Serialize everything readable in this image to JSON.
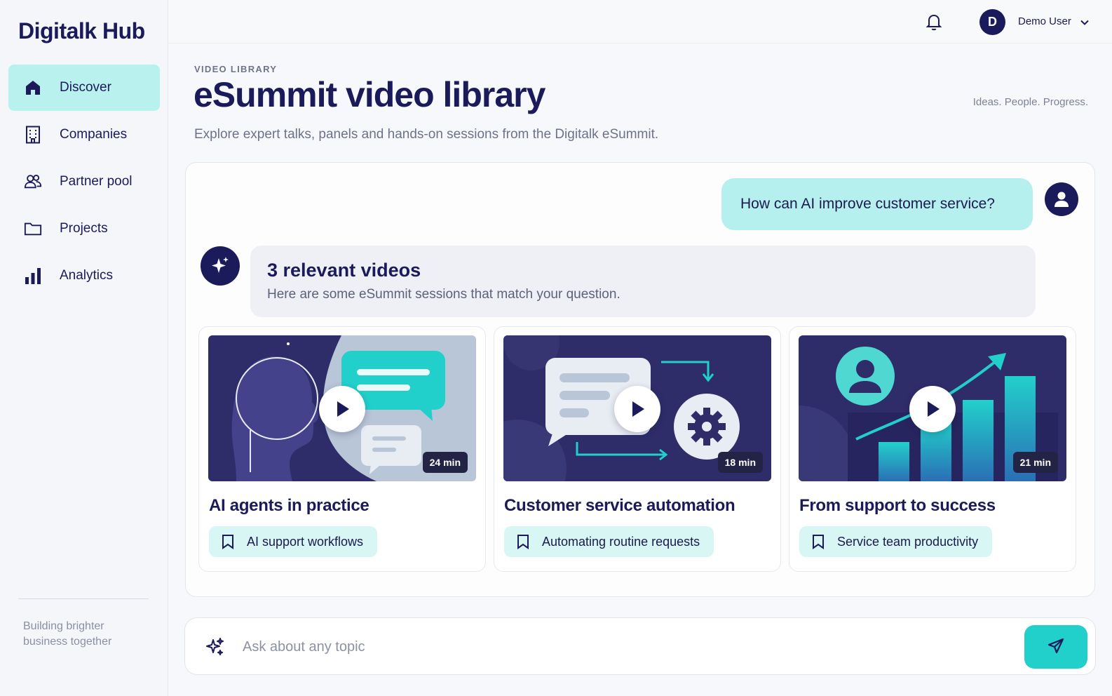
{
  "app": {
    "logo": "Digitalk Hub"
  },
  "sidebar": {
    "items": [
      {
        "label": "Discover",
        "icon": "home-icon",
        "active": true
      },
      {
        "label": "Companies",
        "icon": "building-icon"
      },
      {
        "label": "Partner pool",
        "icon": "users-icon"
      },
      {
        "label": "Projects",
        "icon": "folder-icon"
      },
      {
        "label": "Analytics",
        "icon": "bar-chart-icon"
      }
    ],
    "tagline": "Building brighter business together"
  },
  "topbar": {
    "notifications_icon": "bell-icon",
    "avatar_initial": "D",
    "user_name": "Demo User",
    "menu_icon": "chevron-down-icon"
  },
  "header": {
    "eyebrow": "VIDEO LIBRARY",
    "title": "eSummit video library",
    "subtitle": "Explore expert talks, panels and hands-on sessions from the Digitalk eSummit.",
    "slogan": "Ideas. People. Progress."
  },
  "chat": {
    "user_message": "How can AI improve customer service?",
    "ai_title": "3 relevant videos",
    "ai_text": "Here are some eSummit sessions that match your question.",
    "videos": [
      {
        "title": "AI agents in practice",
        "duration": "24 min",
        "tag": "AI support workflows"
      },
      {
        "title": "Customer service automation",
        "duration": "18 min",
        "tag": "Automating routine requests"
      },
      {
        "title": "From support to success",
        "duration": "21 min",
        "tag": "Service team productivity"
      }
    ]
  },
  "composer": {
    "placeholder": "Ask about any topic",
    "send_icon": "send-icon",
    "spark_icon": "sparkle-icon"
  },
  "colors": {
    "brand_navy": "#1b1a5a",
    "accent_teal": "#22d0cb",
    "active_nav": "#b9f1ef",
    "tag_bg": "#d8f6f4"
  }
}
